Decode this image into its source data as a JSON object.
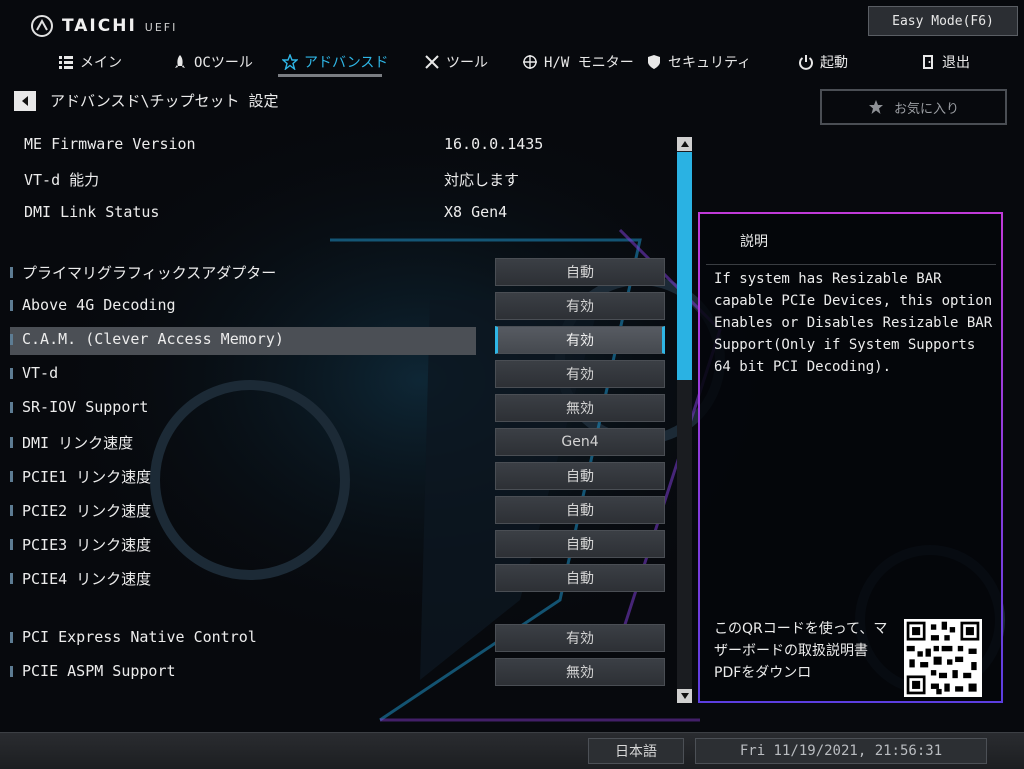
{
  "header": {
    "logo_text": "TAICHI",
    "logo_sub": "UEFI",
    "easy_mode_label": "Easy Mode(F6)"
  },
  "nav": {
    "items": [
      {
        "label": "メイン",
        "icon": "list-icon"
      },
      {
        "label": "OCツール",
        "icon": "rocket-icon"
      },
      {
        "label": "アドバンスド",
        "icon": "star-icon",
        "active": true
      },
      {
        "label": "ツール",
        "icon": "tools-icon"
      },
      {
        "label": "H/W モニター",
        "icon": "crosshair-icon"
      },
      {
        "label": "セキュリティ",
        "icon": "shield-icon"
      },
      {
        "label": "起動",
        "icon": "power-icon"
      },
      {
        "label": "退出",
        "icon": "exit-icon"
      }
    ],
    "active_color": "#2fb6e6"
  },
  "breadcrumb": "アドバンスド\\チップセット 設定",
  "favorite_label": "お気に入り",
  "info": [
    {
      "label": "ME Firmware Version",
      "value": "16.0.0.1435"
    },
    {
      "label": "VT-d 能力",
      "value": "対応します"
    },
    {
      "label": "DMI Link Status",
      "value": "X8  Gen4"
    }
  ],
  "settings": [
    {
      "label": "プライマリグラフィックスアダプター",
      "value": "自動"
    },
    {
      "label": "Above 4G Decoding",
      "value": "有効"
    },
    {
      "label": "C.A.M. (Clever Access Memory)",
      "value": "有効",
      "selected": true
    },
    {
      "label": "VT-d",
      "value": "有効"
    },
    {
      "label": "SR-IOV Support",
      "value": "無効"
    },
    {
      "label": "DMI リンク速度",
      "value": "Gen4"
    },
    {
      "label": "PCIE1 リンク速度",
      "value": "自動"
    },
    {
      "label": "PCIE2 リンク速度",
      "value": "自動"
    },
    {
      "label": "PCIE3 リンク速度",
      "value": "自動"
    },
    {
      "label": "PCIE4 リンク速度",
      "value": "自動"
    },
    {
      "label": "PCI Express Native Control",
      "value": "有効"
    },
    {
      "label": "PCIE ASPM Support",
      "value": "無効"
    }
  ],
  "description": {
    "title": "説明",
    "text": "If system has Resizable BAR capable PCIe Devices, this option Enables or Disables Resizable BAR Support(Only if System Supports 64 bit PCI Decoding).",
    "qr_text": "このQRコードを使って、マザーボードの取扱説明書PDFをダウンロ"
  },
  "footer": {
    "language": "日本語",
    "datetime": "Fri 11/19/2021, 21:56:31"
  },
  "colors": {
    "accent": "#2fb6e6",
    "panel_border_top": "#c03ad8",
    "panel_border_bottom": "#5c3ee0"
  }
}
